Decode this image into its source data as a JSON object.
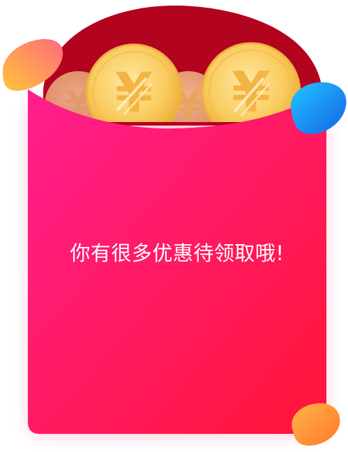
{
  "message": "你有很多优惠待领取哦!",
  "colors": {
    "envelope_top": "#FF1E8C",
    "envelope_bottom": "#FF1535",
    "flap": "#B2031F",
    "coin_gold": "#F7C350",
    "coin_light": "#FDE39A",
    "blob_blue": "#1E8BF0",
    "blob_orange": "#FFA836",
    "text": "#FFFFFF"
  },
  "icons": [
    "yuan-coin-icon",
    "decorative-blob-icon"
  ]
}
